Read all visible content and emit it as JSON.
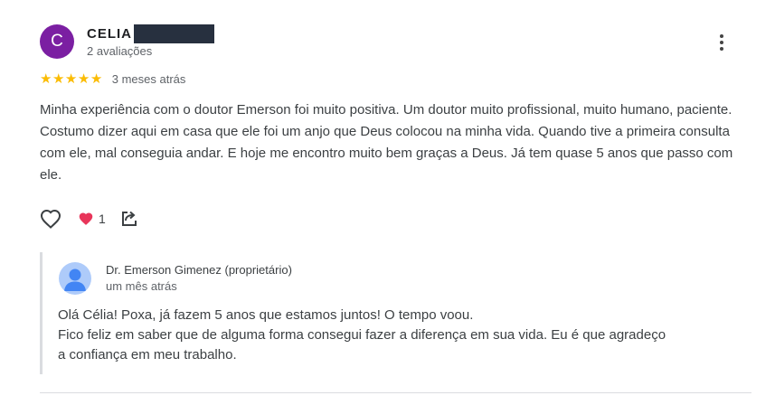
{
  "review": {
    "avatar_letter": "C",
    "author_name": "CELIA",
    "author_reviews": "2 avaliações",
    "rating": 5,
    "stars": [
      "★",
      "★",
      "★",
      "★",
      "★"
    ],
    "time_ago": "3 meses atrás",
    "text": "Minha experiência com o doutor Emerson foi muito positiva. Um doutor muito profissional, muito humano, paciente. Costumo dizer aqui em casa que ele foi um anjo que Deus colocou na minha vida. Quando tive a primeira consulta com ele, mal conseguia andar. E hoje me encontro muito bem graças a Deus. Já tem quase 5 anos que passo com ele.",
    "reactions_count": "1"
  },
  "reply": {
    "author": "Dr. Emerson Gimenez (proprietário)",
    "time_ago": "um mês atrás",
    "lines": [
      "Olá Célia! Poxa, já fazem 5 anos que estamos juntos! O tempo voou.",
      "Fico feliz em saber que de alguma forma consegui fazer a diferença em sua vida. Eu é que agradeço",
      "a confiança em meu trabalho."
    ]
  },
  "colors": {
    "avatar_bg": "#7b1fa2",
    "star": "#fbbc04",
    "heart_reaction": "#e8355a",
    "reply_avatar": "#aecbfa",
    "reply_avatar_figure": "#4285f4"
  },
  "icons": [
    "more-vert-icon",
    "heart-outline-icon",
    "heart-reaction-icon",
    "share-icon",
    "person-icon"
  ]
}
